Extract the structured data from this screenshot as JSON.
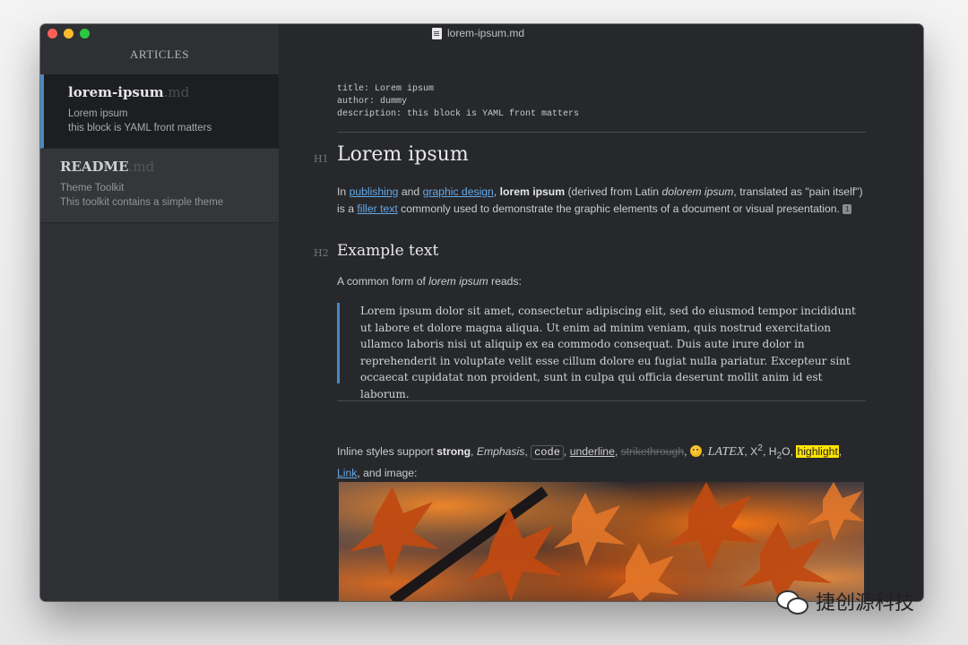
{
  "window": {
    "title": "lorem-ipsum.md"
  },
  "sidebar": {
    "header": "ARTICLES",
    "files": [
      {
        "name": "lorem-ipsum",
        "ext": ".md",
        "line1": "Lorem ipsum",
        "line2": "this block is YAML front matters"
      },
      {
        "name": "README",
        "ext": ".md",
        "line1": "Theme Toolkit",
        "line2": "This toolkit contains a simple theme"
      }
    ]
  },
  "editor": {
    "yaml": [
      "title: Lorem ipsum",
      "author: dummy",
      "description: this block is YAML front matters"
    ],
    "h1_marker": "H1",
    "h2_marker": "H2",
    "heading1": "Lorem ipsum",
    "paragraph1": {
      "t1": "In ",
      "link1": "publishing",
      "t2": " and ",
      "link2": "graphic design",
      "t3": ", ",
      "strong": "lorem ipsum",
      "t4": " (derived from Latin ",
      "em": "dolorem ipsum",
      "t5": ", translated as \"pain itself\") is a ",
      "link3": "filler text",
      "t6": " commonly used to demonstrate the graphic elements of a document or visual presentation. ",
      "footnote": "1"
    },
    "heading2": "Example text",
    "paragraph2": {
      "t1": "A common form of ",
      "em": "lorem ipsum",
      "t2": " reads:"
    },
    "blockquote": "Lorem ipsum dolor sit amet, consectetur adipiscing elit, sed do eiusmod tempor incididunt ut labore et dolore magna aliqua. Ut enim ad minim veniam, quis nostrud exercitation ullamco laboris nisi ut aliquip ex ea commodo consequat. Duis aute irure dolor in reprehenderit in voluptate velit esse cillum dolore eu fugiat nulla pariatur. Excepteur sint occaecat cupidatat non proident, sunt in culpa qui officia deserunt mollit anim id est laborum.",
    "inline": {
      "t1": "Inline styles support ",
      "strong": "strong",
      "sep1": ", ",
      "em": "Emphasis",
      "sep2": ", ",
      "code": "code",
      "sep3": ", ",
      "underline": "underline",
      "sep4": ", ",
      "strike": "strikethrough",
      "sep5": ", ",
      "sep6": ", ",
      "latex": "LATEX",
      "sep7": ", X",
      "sup": "2",
      "sep8": ", H",
      "sub": "2",
      "sep9": "O, ",
      "highlight": "highlight",
      "sep10": ", ",
      "link": "Link",
      "t2": ", and image:"
    }
  },
  "watermark": {
    "text": "捷创源科技"
  }
}
